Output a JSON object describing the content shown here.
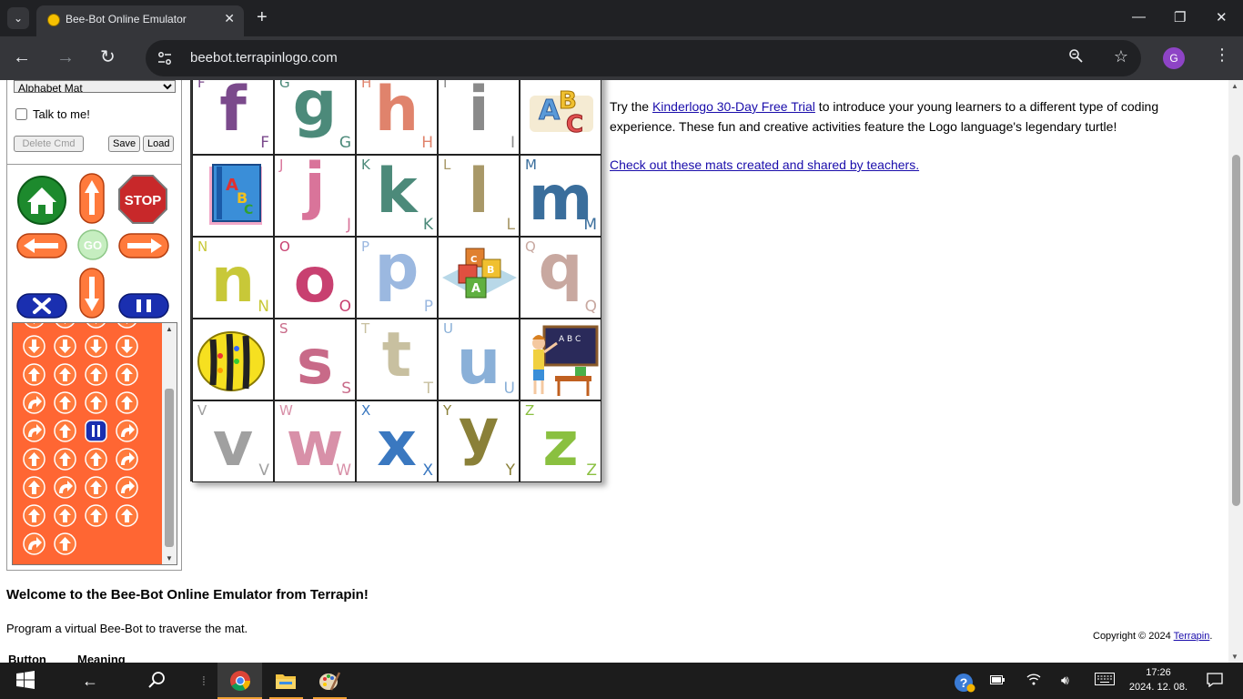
{
  "browser": {
    "tab_title": "Bee-Bot Online Emulator",
    "tab_close": "✕",
    "new_tab": "+",
    "url": "beebot.terrapinlogo.com",
    "profile_initial": "G",
    "back": "←",
    "forward": "→",
    "reload": "↻",
    "minimize": "—",
    "restore": "❐",
    "close": "✕"
  },
  "panel": {
    "mat_select_value": "Alphabet Mat",
    "talk_label": "Talk to me!",
    "delete_cmd": "Delete Cmd",
    "save": "Save",
    "load": "Load",
    "stop_label": "STOP",
    "go_label": "GO",
    "program_commands": [
      "down",
      "down",
      "down",
      "down",
      "up",
      "up",
      "up",
      "up",
      "right",
      "up",
      "up",
      "up",
      "right",
      "up",
      "pause",
      "right",
      "up",
      "up",
      "up",
      "right",
      "up",
      "right",
      "up",
      "right",
      "up",
      "up",
      "up",
      "up",
      "right",
      "up"
    ]
  },
  "mat": {
    "cells": [
      {
        "type": "letter",
        "char": "f",
        "big_color": "#7b4a8c",
        "corner_color": "#7b4a8c",
        "tl": "F",
        "br": "F"
      },
      {
        "type": "letter",
        "char": "g",
        "big_color": "#4c8a7a",
        "corner_color": "#4c8a7a",
        "tl": "G",
        "br": "G"
      },
      {
        "type": "letter",
        "char": "h",
        "big_color": "#e0836c",
        "corner_color": "#e0836c",
        "tl": "H",
        "br": "H"
      },
      {
        "type": "letter",
        "char": "i",
        "big_color": "#8a8a8a",
        "corner_color": "#8a8a8a",
        "tl": "I",
        "br": "I"
      },
      {
        "type": "picture",
        "name": "abc-letters"
      },
      {
        "type": "picture",
        "name": "abc-book"
      },
      {
        "type": "letter",
        "char": "j",
        "big_color": "#d9749a",
        "corner_color": "#d9749a",
        "tl": "J",
        "br": "J"
      },
      {
        "type": "letter",
        "char": "k",
        "big_color": "#4c8a7a",
        "corner_color": "#4c8a7a",
        "tl": "K",
        "br": "K"
      },
      {
        "type": "letter",
        "char": "l",
        "big_color": "#a89868",
        "corner_color": "#a89868",
        "tl": "L",
        "br": "L"
      },
      {
        "type": "letter",
        "char": "m",
        "big_color": "#3a6e9c",
        "corner_color": "#3a6e9c",
        "tl": "M",
        "br": "M"
      },
      {
        "type": "letter",
        "char": "n",
        "big_color": "#c8c838",
        "corner_color": "#c8c838",
        "tl": "N",
        "br": "N"
      },
      {
        "type": "letter",
        "char": "o",
        "big_color": "#c84070",
        "corner_color": "#c84070",
        "tl": "O",
        "br": "O"
      },
      {
        "type": "letter",
        "char": "p",
        "big_color": "#9bb8e0",
        "corner_color": "#9bb8e0",
        "tl": "P",
        "br": "P"
      },
      {
        "type": "picture",
        "name": "abc-blocks"
      },
      {
        "type": "letter",
        "char": "q",
        "big_color": "#c8a8a0",
        "corner_color": "#c8a8a0",
        "tl": "Q",
        "br": "Q"
      },
      {
        "type": "picture",
        "name": "bee-bot"
      },
      {
        "type": "letter",
        "char": "s",
        "big_color": "#c86a88",
        "corner_color": "#c86a88",
        "tl": "S",
        "br": "S"
      },
      {
        "type": "letter",
        "char": "t",
        "big_color": "#c8c0a0",
        "corner_color": "#c8c0a0",
        "tl": "T",
        "br": "T"
      },
      {
        "type": "letter",
        "char": "u",
        "big_color": "#8ab0d8",
        "corner_color": "#8ab0d8",
        "tl": "U",
        "br": "U"
      },
      {
        "type": "picture",
        "name": "teacher"
      },
      {
        "type": "letter",
        "char": "v",
        "big_color": "#a0a0a0",
        "corner_color": "#a0a0a0",
        "tl": "V",
        "br": "V"
      },
      {
        "type": "letter",
        "char": "w",
        "big_color": "#d890a8",
        "corner_color": "#d890a8",
        "tl": "W",
        "br": "W"
      },
      {
        "type": "letter",
        "char": "x",
        "big_color": "#3a78c0",
        "corner_color": "#3a78c0",
        "tl": "X",
        "br": "X"
      },
      {
        "type": "letter",
        "char": "y",
        "big_color": "#8a8038",
        "corner_color": "#8a8038",
        "tl": "Y",
        "br": "Y"
      },
      {
        "type": "letter",
        "char": "z",
        "big_color": "#8ac040",
        "corner_color": "#8ac040",
        "tl": "Z",
        "br": "Z"
      }
    ]
  },
  "info": {
    "try_prefix": "Try the ",
    "trial_link": "Kinderlogo 30-Day Free Trial",
    "try_suffix": " to introduce your young learners to a different type of coding experience. These fun and creative activities feature the Logo language's legendary turtle!",
    "mats_link": "Check out these mats created and shared by teachers."
  },
  "footer": {
    "welcome": "Welcome to the Bee-Bot Online Emulator from Terrapin!",
    "program_text": "Program a virtual Bee-Bot to traverse the mat.",
    "copyright_prefix": "Copyright © 2024 ",
    "copyright_link": "Terrapin",
    "copyright_suffix": ".",
    "col_button": "Button",
    "col_meaning": "Meaning"
  },
  "taskbar": {
    "time": "17:26",
    "date": "2024. 12. 08."
  }
}
